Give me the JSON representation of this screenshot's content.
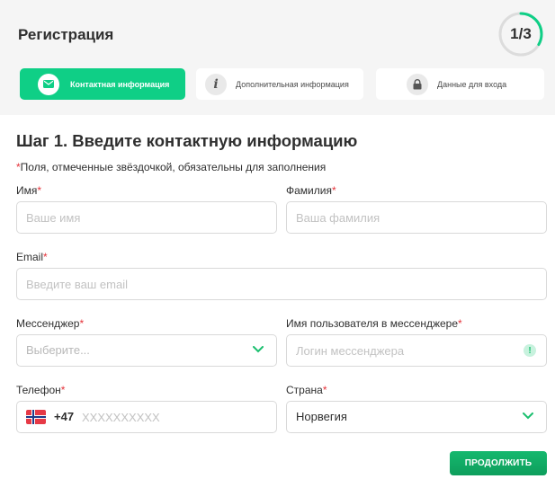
{
  "header": {
    "title": "Регистрация",
    "progress_text": "1/3",
    "progress_fraction": 0.3333,
    "accent_color": "#0fcf86"
  },
  "steps": [
    {
      "label": "Контактная информация",
      "icon": "envelope-icon",
      "active": true
    },
    {
      "label": "Дополнительная информация",
      "icon": "info-icon",
      "active": false
    },
    {
      "label": "Данные для входа",
      "icon": "lock-icon",
      "active": false
    }
  ],
  "form": {
    "heading": "Шаг 1. Введите контактную информацию",
    "required_star": "*",
    "required_note": "Поля, отмеченные звёздочкой, обязательны для заполнения",
    "first_name": {
      "label": "Имя",
      "placeholder": "Ваше имя"
    },
    "last_name": {
      "label": "Фамилия",
      "placeholder": "Ваша фамилия"
    },
    "email": {
      "label": "Email",
      "placeholder": "Введите ваш email"
    },
    "messenger": {
      "label": "Мессенджер",
      "placeholder": "Выберите..."
    },
    "messenger_username": {
      "label": "Имя пользователя в мессенджере",
      "placeholder": "Логин мессенджера",
      "warning_icon": "!"
    },
    "phone": {
      "label": "Телефон",
      "flag": "norway-flag-icon",
      "code": "+47",
      "placeholder": "XXXXXXXXXX"
    },
    "country": {
      "label": "Страна",
      "value": "Норвегия"
    },
    "submit_label": "ПРОДОЛЖИТЬ"
  }
}
